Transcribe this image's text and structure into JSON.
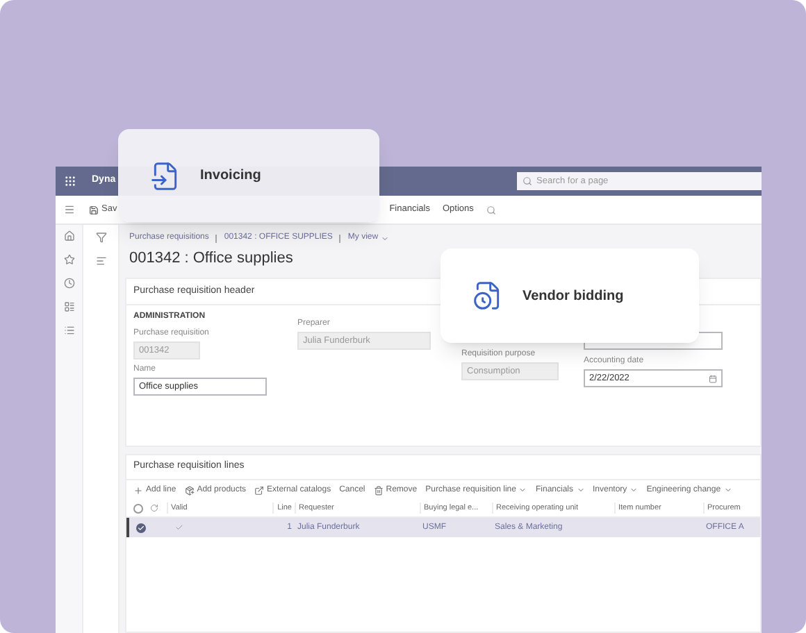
{
  "cards": [
    {
      "kind": "invoice",
      "label": "Invoicing"
    },
    {
      "kind": "bidding",
      "label": "Vendor bidding"
    }
  ],
  "top_bar": {
    "app_name": "Dyna",
    "search": {
      "placeholder": "Search for a page"
    }
  },
  "action_bar": {
    "save": "Sav",
    "menus": [
      "Financials",
      "Options"
    ]
  },
  "breadcrumb": [
    "Purchase requisitions",
    "001342 : OFFICE SUPPLIES",
    "My view"
  ],
  "page_title": "001342 : Office supplies",
  "header_section": {
    "title": "Purchase requisition header",
    "group": "ADMINISTRATION",
    "fields": [
      {
        "label": "Purchase requisition",
        "value": "001342",
        "disabled": true
      },
      {
        "label": "Name",
        "value": "Office supplies",
        "disabled": false
      },
      {
        "label": "Preparer",
        "value": "Julia Funderburk",
        "disabled": true
      },
      {
        "label": "Requisition purpose",
        "value": "Consumption",
        "disabled": true
      },
      {
        "label": "Accounting date",
        "value": "2/22/2022",
        "disabled": false
      }
    ]
  },
  "lines_section": {
    "title": "Purchase requisition lines",
    "toolbar": [
      {
        "kind": "plus",
        "label": "Add line"
      },
      {
        "kind": "products",
        "label": "Add products"
      },
      {
        "kind": "external",
        "label": "External catalogs"
      },
      {
        "kind": "plain",
        "label": "Cancel"
      },
      {
        "kind": "trash",
        "label": "Remove"
      },
      {
        "kind": "menu",
        "label": "Purchase requisition line"
      },
      {
        "kind": "menu",
        "label": "Financials"
      },
      {
        "kind": "menu",
        "label": "Inventory"
      },
      {
        "kind": "menu",
        "label": "Engineering change"
      }
    ],
    "columns": [
      "Valid",
      "Line",
      "Requester",
      "Buying legal e...",
      "Receiving operating unit",
      "Item number",
      "Procurem"
    ],
    "all_selected": false,
    "rows": [
      {
        "selected": true,
        "valid": true,
        "cells": [
          "",
          "1",
          "Julia Funderburk",
          "USMF",
          "Sales & Marketing",
          "",
          "OFFICE A"
        ]
      }
    ]
  }
}
